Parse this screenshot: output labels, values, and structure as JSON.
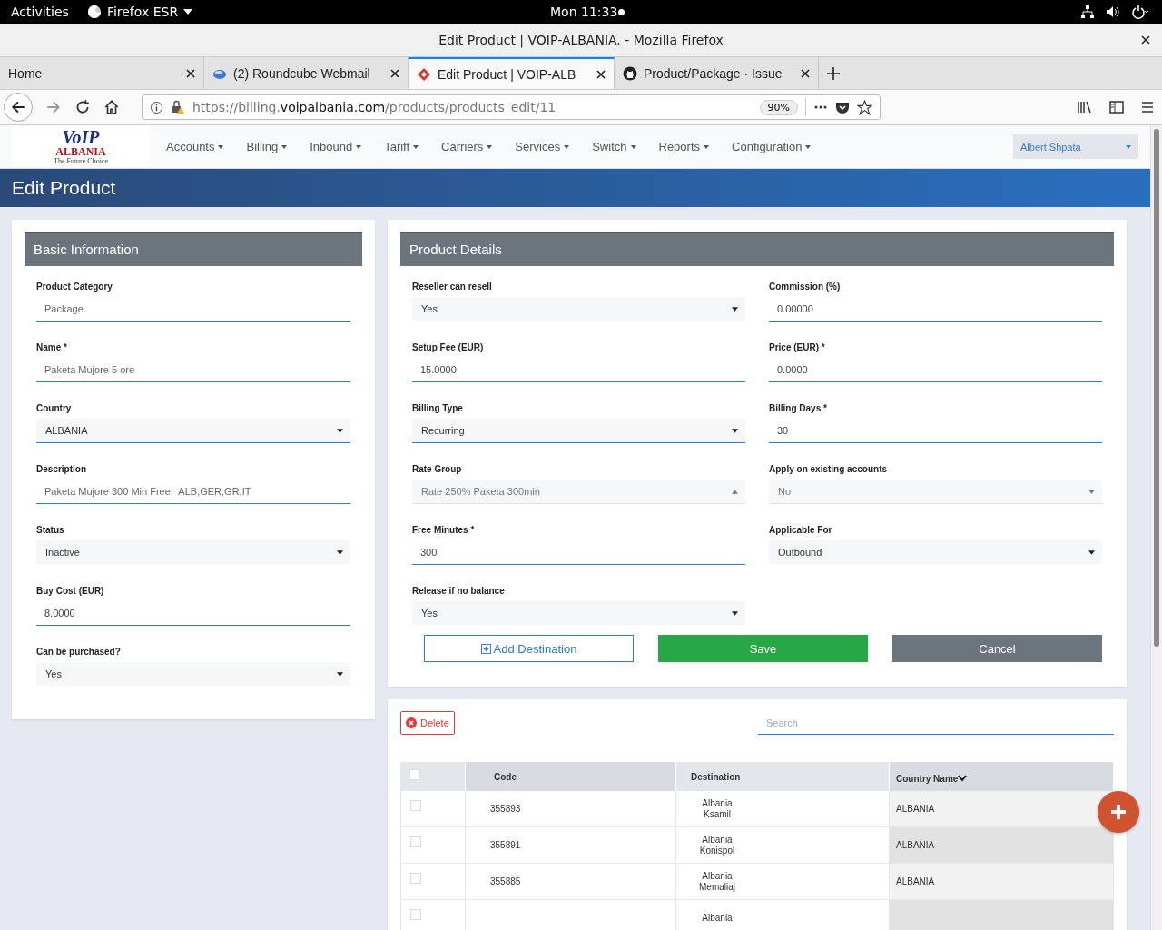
{
  "topbar": {
    "activities": "Activities",
    "app": "Firefox ESR",
    "clock": "Mon 11:33"
  },
  "window": {
    "title": "Edit Product | VOIP-ALBANIA. - Mozilla Firefox"
  },
  "tabs": [
    {
      "label": "Home",
      "selected": false
    },
    {
      "label": "(2) Roundcube Webmail",
      "selected": false
    },
    {
      "label": "Edit Product | VOIP-ALB",
      "selected": true
    },
    {
      "label": "Product/Package · Issue",
      "selected": false
    }
  ],
  "address": {
    "prefix": "https://billing.",
    "domain": "voipalbania.com",
    "path": "/products/products_edit/11",
    "zoom": "90%"
  },
  "site": {
    "logo_text": "VoIP",
    "logo_sub": "ALBANIA",
    "logo_tag": "The Future Choice",
    "menu": [
      "Accounts",
      "Billing",
      "Inbound",
      "Tariff",
      "Carriers",
      "Services",
      "Switch",
      "Reports",
      "Configuration"
    ],
    "user": "Albert Shpata"
  },
  "page_title": "Edit Product",
  "basic": {
    "title": "Basic Information",
    "fields": [
      {
        "label": "Product Category",
        "kind": "input",
        "value": "Package",
        "disabled": true
      },
      {
        "label": "Name *",
        "kind": "input",
        "value": "Paketa Mujore 5 ore",
        "disabled": true
      },
      {
        "label": "Country",
        "kind": "select",
        "value": "ALBANIA",
        "disabled": false,
        "focused": true
      },
      {
        "label": "Description",
        "kind": "input",
        "value": "Paketa Mujore 300 Min Free   ALB,GER,GR,IT",
        "disabled": true
      },
      {
        "label": "Status",
        "kind": "select",
        "value": "Inactive",
        "disabled": false,
        "focused": false
      },
      {
        "label": "Buy Cost (EUR)",
        "kind": "input",
        "value": "8.0000",
        "disabled": false
      },
      {
        "label": "Can be purchased?",
        "kind": "select",
        "value": "Yes",
        "disabled": false,
        "focused": false
      }
    ]
  },
  "details": {
    "title": "Product Details",
    "left": [
      {
        "label": "Reseller can resell",
        "kind": "select",
        "value": "Yes",
        "disabled": false,
        "focused": false
      },
      {
        "label": "Setup Fee (EUR)",
        "kind": "input",
        "value": "15.0000",
        "disabled": false
      },
      {
        "label": "Billing Type",
        "kind": "select",
        "value": "Recurring",
        "disabled": false,
        "focused": true
      },
      {
        "label": "Rate Group",
        "kind": "select",
        "value": "Rate 250% Paketa 300min",
        "disabled": true,
        "focused": false,
        "open": true
      },
      {
        "label": "Free Minutes *",
        "kind": "input",
        "value": "300",
        "disabled": false
      },
      {
        "label": "Release if no balance",
        "kind": "select",
        "value": "Yes",
        "disabled": false,
        "focused": false
      }
    ],
    "right": [
      {
        "label": "Commission (%)",
        "kind": "input",
        "value": "0.00000",
        "disabled": false
      },
      {
        "label": "Price (EUR) *",
        "kind": "input",
        "value": "0.0000",
        "disabled": false
      },
      {
        "label": "Billing Days *",
        "kind": "input",
        "value": "30",
        "disabled": false
      },
      {
        "label": "Apply on existing accounts",
        "kind": "select",
        "value": "No",
        "disabled": true,
        "focused": false
      },
      {
        "label": "Applicable For",
        "kind": "select",
        "value": "Outbound",
        "disabled": false,
        "focused": false
      }
    ],
    "buttons": [
      {
        "label": "Add Destination",
        "kind": "outline"
      },
      {
        "label": "Save",
        "kind": "primary"
      },
      {
        "label": "Cancel",
        "kind": "secondary"
      }
    ]
  },
  "destinations": {
    "delete": "Delete",
    "search_placeholder": "Search",
    "select_all_checked": false,
    "columns": [
      "Code",
      "Destination",
      "Country Name"
    ],
    "rows": [
      {
        "checked": false,
        "code": "355893",
        "destination": [
          "Albania",
          "Ksamil"
        ],
        "country": "ALBANIA"
      },
      {
        "checked": false,
        "code": "355891",
        "destination": [
          "Albania",
          "Konispol"
        ],
        "country": "ALBANIA"
      },
      {
        "checked": false,
        "code": "355885",
        "destination": [
          "Albania",
          "Memaliaj"
        ],
        "country": "ALBANIA"
      },
      {
        "checked": false,
        "destination": [
          "Albania"
        ]
      }
    ]
  }
}
